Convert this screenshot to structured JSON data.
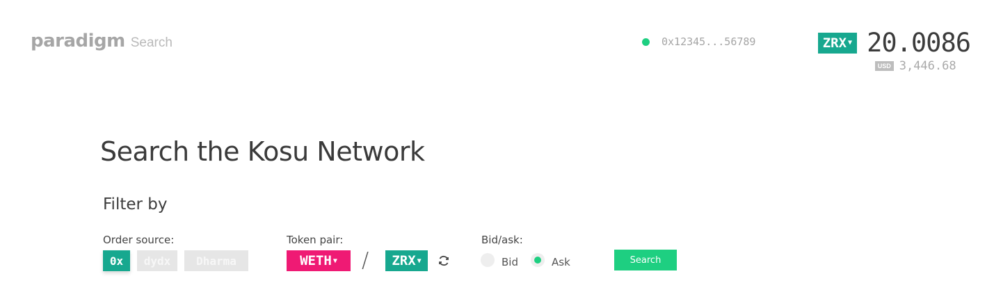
{
  "header": {
    "logo_word": "paradigm",
    "logo_sub": "Search",
    "wallet_address": "0x12345...56789",
    "balance_token": "ZRX",
    "balance_amount": "20.0086",
    "usd_badge": "USD",
    "usd_value": "3,446.68"
  },
  "main": {
    "title": "Search the Kosu Network",
    "filter_title": "Filter by",
    "order_source": {
      "label": "Order source:",
      "options": [
        "0x",
        "dydx",
        "Dharma"
      ],
      "selected": "0x"
    },
    "token_pair": {
      "label": "Token pair:",
      "base": "WETH",
      "separator": "/",
      "quote": "ZRX"
    },
    "bid_ask": {
      "label": "Bid/ask:",
      "options": [
        "Bid",
        "Ask"
      ],
      "selected": "Ask"
    },
    "search_label": "Search"
  },
  "colors": {
    "accent_green": "#1ecf81",
    "teal": "#17a88f",
    "pink": "#ef1a74",
    "inactive_grey": "#e6e6e6"
  },
  "icons": {
    "caret": "chevron-down-icon",
    "swap": "swap-icon",
    "status": "status-dot-icon"
  }
}
